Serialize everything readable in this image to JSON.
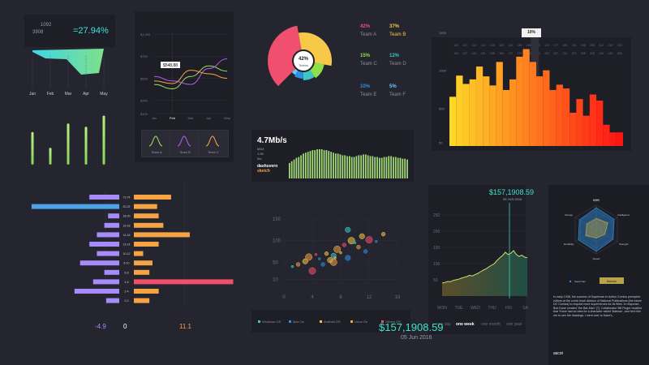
{
  "kpi": {
    "value_a": "1092",
    "value_b": "3908",
    "percent": "=27.94%",
    "months": [
      "Jan",
      "Feb",
      "Mar",
      "Apr",
      "May"
    ],
    "bar_values": [
      0.62,
      0.32,
      0.78,
      0.72,
      0.93
    ]
  },
  "line_panel": {
    "chart_data": {
      "type": "line",
      "categories": [
        "Jan",
        "Feb",
        "Mar",
        "Apr",
        "May"
      ],
      "y_ticks": [
        "$1,000",
        "$750",
        "$500",
        "$250",
        "$100"
      ],
      "ylim": [
        100,
        1000
      ],
      "series": [
        {
          "name": "Team A",
          "color": "#9be15d",
          "values": [
            430,
            380,
            520,
            640,
            580
          ]
        },
        {
          "name": "Team B",
          "color": "#b15ce8",
          "values": [
            520,
            470,
            430,
            610,
            720
          ]
        },
        {
          "name": "Team C",
          "color": "#f6a344",
          "values": [
            470,
            440,
            590,
            550,
            500
          ]
        }
      ],
      "tooltip": "$548,88"
    },
    "legend": [
      {
        "label": "Team A",
        "color": "#9be15d"
      },
      {
        "label": "Team B",
        "color": "#b15ce8"
      },
      {
        "label": "Team C",
        "color": "#f6a344"
      }
    ]
  },
  "donut": {
    "center": "42%",
    "center_sub": "Teams",
    "chart_data": {
      "type": "pie",
      "values": [
        42,
        37,
        15,
        12,
        10,
        5
      ],
      "labels": [
        "Team A",
        "Team B",
        "Team C",
        "Team D",
        "Team E",
        "Team F"
      ],
      "colors": [
        "#f0506e",
        "#f7c948",
        "#8ee04a",
        "#3cc7c4",
        "#2f8fe0",
        "#6ec6ff"
      ]
    }
  },
  "teams": [
    {
      "pct": "42%",
      "name": "Team A",
      "color": "#f0506e"
    },
    {
      "pct": "37%",
      "name": "Team B",
      "color": "#f7c948"
    },
    {
      "pct": "15%",
      "name": "Team C",
      "color": "#8ee04a"
    },
    {
      "pct": "12%",
      "name": "Team D",
      "color": "#3cc7c4"
    },
    {
      "pct": "10%",
      "name": "Team E",
      "color": "#2f8fe0"
    },
    {
      "pct": "5%",
      "name": "Team F",
      "color": "#6ec6ff"
    }
  ],
  "bandwidth": {
    "value": "4.7Mb/s",
    "stats": [
      "MAX",
      "1.96",
      "5/s"
    ],
    "brand": "dashuvern",
    "brand_sub": "sketch",
    "chart_data": {
      "type": "bar",
      "values": [
        18,
        20,
        22,
        24,
        25,
        27,
        29,
        30,
        31,
        32,
        33,
        33,
        34,
        34,
        34,
        33,
        33,
        32,
        31,
        30,
        29,
        29,
        28,
        27,
        27,
        26,
        26,
        25,
        25,
        26,
        27,
        27,
        28,
        28,
        27,
        26,
        26,
        25,
        25,
        24,
        24,
        25,
        25,
        26,
        26,
        25,
        25,
        24,
        24,
        23,
        23,
        22
      ]
    }
  },
  "histogram": {
    "label": "10%",
    "y_ticks": [
      "1500",
      "1000",
      "500",
      "50"
    ],
    "chart_data": {
      "type": "bar",
      "values": [
        650,
        930,
        820,
        880,
        1050,
        920,
        800,
        1110,
        740,
        880,
        1180,
        1280,
        1110,
        920,
        1000,
        740,
        810,
        760,
        440,
        620,
        400,
        680,
        600,
        280,
        180,
        180
      ],
      "highlight_index": 10
    }
  },
  "butterfly": {
    "left_label": "-4.9",
    "center_label": "0",
    "right_label": "11.1",
    "chart_data": {
      "type": "bar",
      "categories": [
        "72-74",
        "20-22",
        "18-20",
        "16-18",
        "14-16",
        "13-14",
        "10-12",
        "8-10",
        "6-8",
        "4-6",
        "2-4",
        "0-2"
      ],
      "series": [
        {
          "values": [
            -1.6,
            -4.7,
            -0.6,
            -0.8,
            -1.2,
            -1.6,
            -1.2,
            -2.1,
            -0.8,
            -1.4,
            -2.4,
            -0.7
          ]
        },
        {
          "values": [
            2.4,
            1.5,
            1.6,
            1.9,
            3.6,
            1.6,
            0.6,
            1.2,
            1.0,
            6.4,
            1.6,
            1.0
          ]
        }
      ]
    }
  },
  "scatter": {
    "y_ticks": [
      "150",
      "100",
      "50",
      "10"
    ],
    "x_ticks": [
      "0",
      "4",
      "8",
      "12",
      "16"
    ],
    "legend": [
      {
        "label": "Windows OS",
        "color": "#3cc7c4"
      },
      {
        "label": "Mac Os",
        "color": "#2f8fe0"
      },
      {
        "label": "Android OS",
        "color": "#f7c948"
      },
      {
        "label": "Linux Os",
        "color": "#f6a344"
      },
      {
        "label": "Others OS",
        "color": "#f0506e"
      }
    ],
    "chart_data": {
      "type": "scatter",
      "xlim": [
        0,
        16
      ],
      "ylim": [
        0,
        150
      ],
      "points": [
        [
          1.2,
          40,
          0
        ],
        [
          2,
          45,
          3
        ],
        [
          3,
          52,
          2
        ],
        [
          4,
          30,
          4
        ],
        [
          5,
          58,
          1
        ],
        [
          6,
          70,
          2
        ],
        [
          7,
          65,
          0
        ],
        [
          7.5,
          80,
          3
        ],
        [
          8,
          72,
          2
        ],
        [
          8.5,
          90,
          4
        ],
        [
          9,
          60,
          1
        ],
        [
          9.5,
          100,
          2
        ],
        [
          10,
          95,
          0
        ],
        [
          10.5,
          85,
          3
        ],
        [
          11,
          110,
          2
        ],
        [
          12,
          102,
          4
        ],
        [
          13,
          98,
          1
        ],
        [
          14,
          115,
          2
        ],
        [
          6.5,
          55,
          2
        ],
        [
          7,
          50,
          3
        ],
        [
          7.2,
          60,
          2
        ],
        [
          5.5,
          45,
          1
        ],
        [
          9,
          125,
          0
        ],
        [
          3.5,
          62,
          3
        ],
        [
          4.5,
          68,
          4
        ],
        [
          11.5,
          75,
          1
        ]
      ]
    }
  },
  "area": {
    "value": "$157,1908.59",
    "date": "05 JUN 2016",
    "y_ticks": [
      "250",
      "200",
      "150",
      "100",
      "50"
    ],
    "x_labels": [
      "MON",
      "TUE",
      "WED",
      "THU",
      "FRI",
      "SA"
    ],
    "tabs": [
      "one day",
      "one week",
      "one month",
      "one year"
    ],
    "chart_data": {
      "type": "area",
      "values": [
        40,
        42,
        45,
        44,
        48,
        50,
        52,
        55,
        58,
        60,
        64,
        62,
        66,
        70,
        75,
        80,
        84,
        90,
        95,
        100,
        110,
        118,
        125,
        135,
        128,
        132,
        140,
        128,
        122,
        126,
        120,
        118
      ]
    }
  },
  "radar": {
    "title": "power",
    "axes": [
      "Agility",
      "Intelligence",
      "Strength",
      "Speed",
      "Durability",
      "Energy"
    ],
    "legend": [
      {
        "label": "Superman",
        "color": "#2f8fe0"
      },
      {
        "label": "Batman",
        "color": "#b8a24a"
      }
    ],
    "chart_data": {
      "type": "radar",
      "series": [
        {
          "name": "Superman",
          "values": [
            0.9,
            0.85,
            0.8,
            0.9,
            0.85,
            0.8
          ]
        },
        {
          "name": "Batman",
          "values": [
            0.45,
            0.55,
            0.4,
            0.35,
            0.5,
            0.45
          ]
        }
      ]
    },
    "body": "In early 1938, the success of Superman in Action Comics prompted editors at the comic book division of National Publications (the future DC Comics) to request more superheroes for its titles. In response, Bob Kane created \"the Bat-Man\" [7]. Collaborator Bill Finger recalled that \"Kane had an idea for a character called 'Batman', and he'd like me to see the drawings. I went over to Kane's,",
    "footer": "ascot"
  },
  "bottom": {
    "value": "$157,1908.59",
    "date": "05 Jun 2016"
  }
}
